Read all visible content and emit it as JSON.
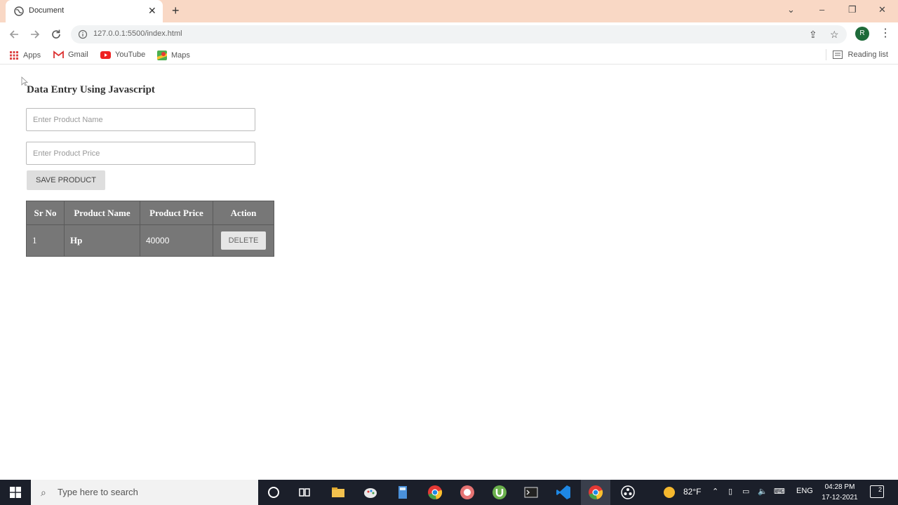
{
  "browser": {
    "tab_title": "Document",
    "url": "127.0.0.1:5500/index.html",
    "profile_initial": "R",
    "bookmarks": [
      "Apps",
      "Gmail",
      "YouTube",
      "Maps"
    ],
    "reading_list": "Reading list"
  },
  "page": {
    "title": "Data Entry Using Javascript",
    "name_placeholder": "Enter Product Name",
    "price_placeholder": "Enter Product Price",
    "save_label": "SAVE PRODUCT",
    "table": {
      "headers": [
        "Sr No",
        "Product Name",
        "Product Price",
        "Action"
      ],
      "rows": [
        {
          "sr": "1",
          "name": "Hp",
          "price": "40000",
          "action": "DELETE"
        }
      ]
    }
  },
  "taskbar": {
    "search_placeholder": "Type here to search",
    "weather": "82°F",
    "language": "ENG",
    "time": "04:28 PM",
    "date": "17-12-2021",
    "notification_count": "2"
  }
}
